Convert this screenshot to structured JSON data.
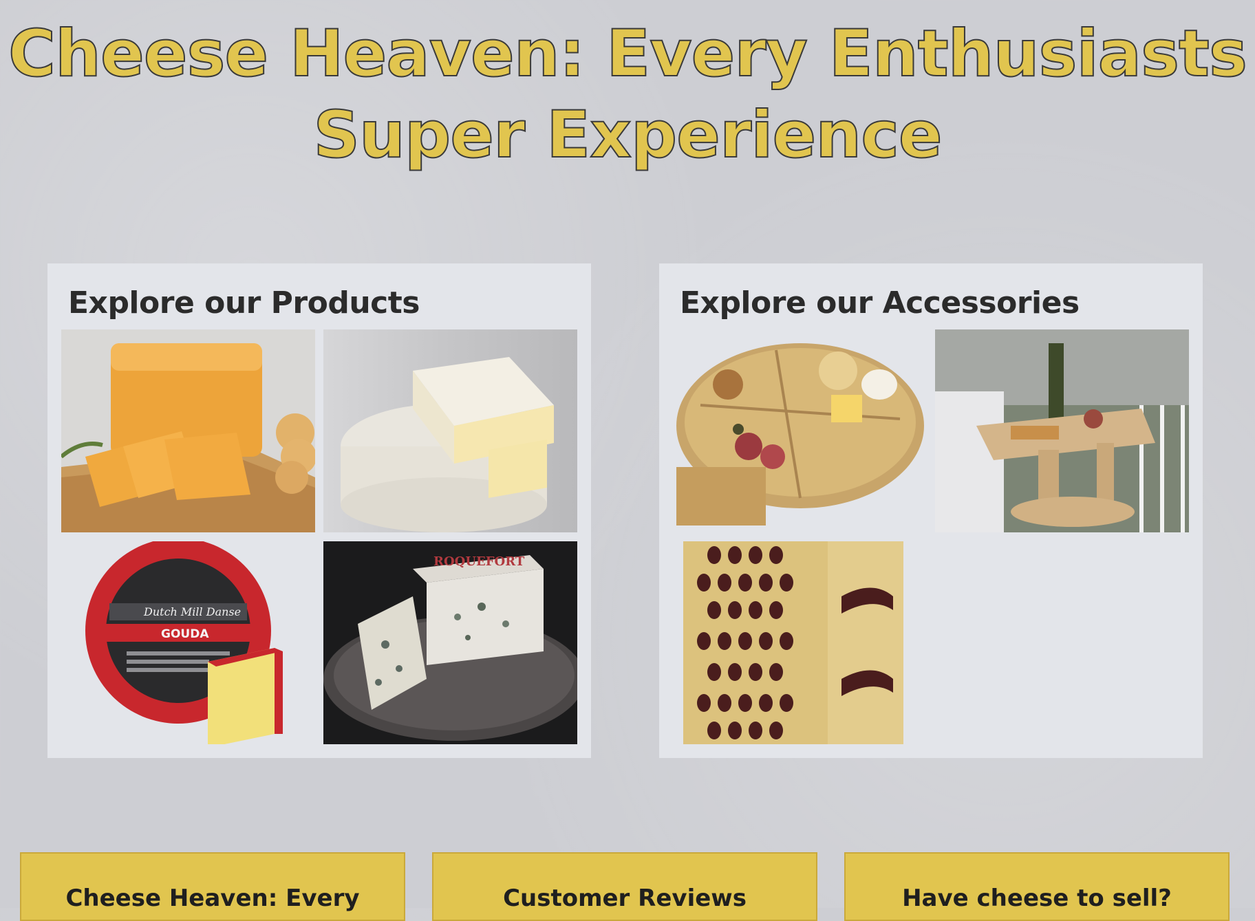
{
  "header": {
    "title_line1": "Cheese Heaven: Every Enthusiasts",
    "title_line2": "Super Experience"
  },
  "products": {
    "heading": "Explore our Products",
    "items": [
      {
        "name": "cheddar-cheese-image"
      },
      {
        "name": "brie-cheese-image"
      },
      {
        "name": "gouda-cheese-image",
        "label": "Dutch Mill Danse",
        "sublabel": "GOUDA"
      },
      {
        "name": "roquefort-cheese-image",
        "label": "ROQUEFORT"
      }
    ]
  },
  "accessories": {
    "heading": "Explore our Accessories",
    "items": [
      {
        "name": "charcuterie-board-image"
      },
      {
        "name": "wine-table-image"
      },
      {
        "name": "cheese-grater-image"
      }
    ]
  },
  "footer_buttons": [
    {
      "label": "Cheese Heaven: Every"
    },
    {
      "label": "Customer Reviews"
    },
    {
      "label": "Have cheese to sell?"
    }
  ],
  "colors": {
    "title_gold": "#e1c54f",
    "button_gold": "#e1c54f",
    "background": "#cdced3",
    "panel": "#e3e5ea"
  }
}
